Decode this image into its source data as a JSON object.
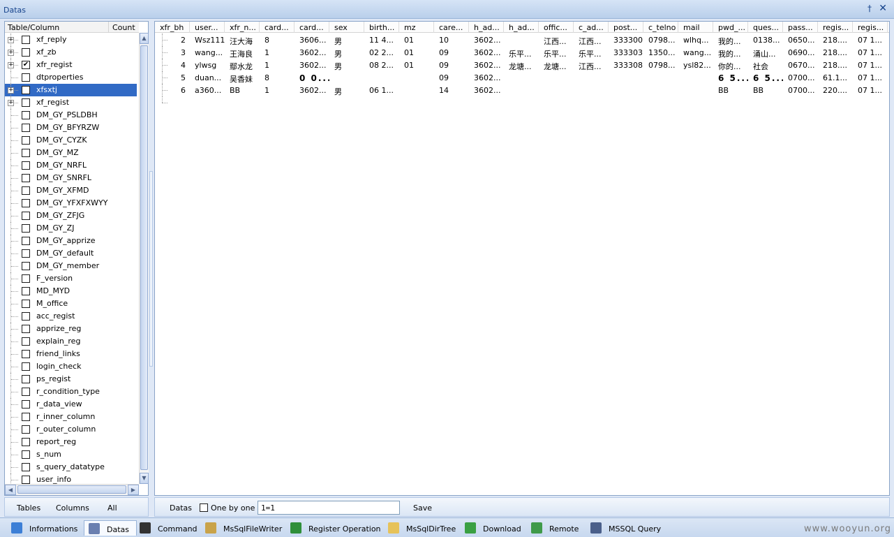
{
  "window": {
    "title": "Datas",
    "pin_glyph": "†",
    "close_glyph": "✕"
  },
  "tree": {
    "header_name": "Table/Column",
    "header_count": "Count",
    "items": [
      {
        "label": "xf_reply",
        "expandable": true,
        "checked": false,
        "selected": false
      },
      {
        "label": "xf_zb",
        "expandable": true,
        "checked": false,
        "selected": false
      },
      {
        "label": "xfr_regist",
        "expandable": true,
        "checked": true,
        "selected": false
      },
      {
        "label": "dtproperties",
        "expandable": false,
        "checked": false,
        "selected": false
      },
      {
        "label": "xfsxtj",
        "expandable": true,
        "checked": false,
        "selected": true
      },
      {
        "label": "xf_regist",
        "expandable": true,
        "checked": false,
        "selected": false
      },
      {
        "label": "DM_GY_PSLDBH",
        "expandable": false,
        "checked": false,
        "selected": false
      },
      {
        "label": "DM_GY_BFYRZW",
        "expandable": false,
        "checked": false,
        "selected": false
      },
      {
        "label": "DM_GY_CYZK",
        "expandable": false,
        "checked": false,
        "selected": false
      },
      {
        "label": "DM_GY_MZ",
        "expandable": false,
        "checked": false,
        "selected": false
      },
      {
        "label": "DM_GY_NRFL",
        "expandable": false,
        "checked": false,
        "selected": false
      },
      {
        "label": "DM_GY_SNRFL",
        "expandable": false,
        "checked": false,
        "selected": false
      },
      {
        "label": "DM_GY_XFMD",
        "expandable": false,
        "checked": false,
        "selected": false
      },
      {
        "label": "DM_GY_YFXFXWYY",
        "expandable": false,
        "checked": false,
        "selected": false
      },
      {
        "label": "DM_GY_ZFJG",
        "expandable": false,
        "checked": false,
        "selected": false
      },
      {
        "label": "DM_GY_ZJ",
        "expandable": false,
        "checked": false,
        "selected": false
      },
      {
        "label": "DM_GY_apprize",
        "expandable": false,
        "checked": false,
        "selected": false
      },
      {
        "label": "DM_GY_default",
        "expandable": false,
        "checked": false,
        "selected": false
      },
      {
        "label": "DM_GY_member",
        "expandable": false,
        "checked": false,
        "selected": false
      },
      {
        "label": "F_version",
        "expandable": false,
        "checked": false,
        "selected": false
      },
      {
        "label": "MD_MYD",
        "expandable": false,
        "checked": false,
        "selected": false
      },
      {
        "label": "M_office",
        "expandable": false,
        "checked": false,
        "selected": false
      },
      {
        "label": "acc_regist",
        "expandable": false,
        "checked": false,
        "selected": false
      },
      {
        "label": "apprize_reg",
        "expandable": false,
        "checked": false,
        "selected": false
      },
      {
        "label": "explain_reg",
        "expandable": false,
        "checked": false,
        "selected": false
      },
      {
        "label": "friend_links",
        "expandable": false,
        "checked": false,
        "selected": false
      },
      {
        "label": "login_check",
        "expandable": false,
        "checked": false,
        "selected": false
      },
      {
        "label": "ps_regist",
        "expandable": false,
        "checked": false,
        "selected": false
      },
      {
        "label": "r_condition_type",
        "expandable": false,
        "checked": false,
        "selected": false
      },
      {
        "label": "r_data_view",
        "expandable": false,
        "checked": false,
        "selected": false
      },
      {
        "label": "r_inner_column",
        "expandable": false,
        "checked": false,
        "selected": false
      },
      {
        "label": "r_outer_column",
        "expandable": false,
        "checked": false,
        "selected": false
      },
      {
        "label": "report_reg",
        "expandable": false,
        "checked": false,
        "selected": false
      },
      {
        "label": "s_num",
        "expandable": false,
        "checked": false,
        "selected": false
      },
      {
        "label": "s_query_datatype",
        "expandable": false,
        "checked": false,
        "selected": false
      },
      {
        "label": "user_info",
        "expandable": false,
        "checked": false,
        "selected": false
      }
    ]
  },
  "grid": {
    "columns": [
      "xfr_bh",
      "user...",
      "xfr_n...",
      "card...",
      "card...",
      "sex",
      "birth...",
      "mz",
      "care...",
      "h_ad...",
      "h_ad...",
      "offic...",
      "c_ad...",
      "post...",
      "c_telno",
      "mail",
      "pwd_...",
      "ques...",
      "pass...",
      "regis...",
      "regis..."
    ],
    "rows": [
      [
        "2",
        "Wsz111",
        "汪大海",
        "8",
        "3606...",
        "男",
        "11 4...",
        "01",
        "10",
        "3602...",
        "",
        "江西...",
        "江西...",
        "333300",
        "0798...",
        "wlhq...",
        "我的...",
        "0138...",
        "0650...",
        "218....",
        "07 1..."
      ],
      [
        "3",
        "wang...",
        "王海良",
        "1",
        "3602...",
        "男",
        "02 2...",
        "01",
        "09",
        "3602...",
        "乐平...",
        "乐平...",
        "乐平...",
        "333303",
        "1350...",
        "wang...",
        "我的...",
        "涌山...",
        "0690...",
        "218....",
        "07 1..."
      ],
      [
        "4",
        "ylwsg",
        "鄢水龙",
        "1",
        "3602...",
        "男",
        "08 2...",
        "01",
        "09",
        "3602...",
        "龙塘...",
        "龙塘...",
        "江西...",
        "333308",
        "0798...",
        "ysl82...",
        "你的...",
        "社会",
        "0670...",
        "218....",
        "07 1..."
      ],
      [
        "5",
        "duan...",
        "吴香妹",
        "8",
        "0 0...",
        "",
        "",
        "",
        "09",
        "3602...",
        "",
        "",
        "",
        "",
        "",
        "",
        "6 5...",
        "6 5...",
        "0700...",
        "61.1...",
        "07 1..."
      ],
      [
        "6",
        "a360...",
        "BB",
        "1",
        "3602...",
        "男",
        "06 1...",
        "",
        "14",
        "3602...",
        "",
        "",
        "",
        "",
        "",
        "",
        "BB",
        "BB",
        "0700...",
        "220....",
        "07 1..."
      ]
    ],
    "bold_cells": [
      [
        3,
        4
      ],
      [
        3,
        16
      ],
      [
        3,
        17
      ]
    ]
  },
  "bottom_left": {
    "tables": "Tables",
    "columns": "Columns",
    "all": "All"
  },
  "bottom_right": {
    "datas": "Datas",
    "one_by_one": "One by one",
    "where_value": "1=1",
    "save": "Save"
  },
  "tabs": [
    {
      "label": "Informations",
      "icon": "info-icon",
      "color": "#3d7fd6",
      "active": false
    },
    {
      "label": "Datas",
      "icon": "database-icon",
      "color": "#6a7fb0",
      "active": true
    },
    {
      "label": "Command",
      "icon": "terminal-icon",
      "color": "#333333",
      "active": false
    },
    {
      "label": "MsSqlFileWriter",
      "icon": "file-writer-icon",
      "color": "#c9a34a",
      "active": false
    },
    {
      "label": "Register Operation",
      "icon": "registry-icon",
      "color": "#2f8f3a",
      "active": false
    },
    {
      "label": "MsSqlDirTree",
      "icon": "folder-icon",
      "color": "#e6c25a",
      "active": false
    },
    {
      "label": "Download",
      "icon": "download-icon",
      "color": "#3aa043",
      "active": false
    },
    {
      "label": "Remote",
      "icon": "globe-icon",
      "color": "#3f9a4a",
      "active": false
    },
    {
      "label": "MSSQL Query",
      "icon": "sql-icon",
      "color": "#4a5f8a",
      "active": false
    }
  ],
  "watermark": "www.wooyun.org"
}
